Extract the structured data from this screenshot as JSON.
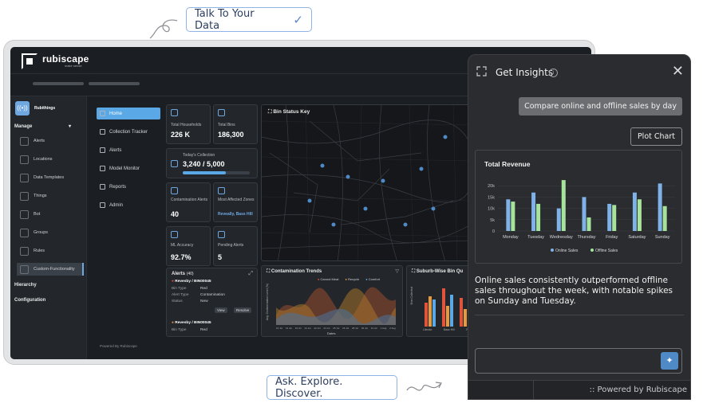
{
  "callouts": {
    "top": "Talk To Your Data",
    "bottom": "Ask. Explore. Discover."
  },
  "app": {
    "brand": "rubiscape",
    "brand_sub": "make sense",
    "workspace": "Rubithings",
    "workspace_icon": "((•))",
    "nav_section": "Manage",
    "nav_items": [
      "Alerts",
      "Locations",
      "Data Templates",
      "Things",
      "Bot",
      "Groups",
      "Rules",
      "Custom-Functionality"
    ],
    "nav_bottom": [
      "Hierarchy",
      "Configuration"
    ],
    "menu_items": [
      "Home",
      "Collection Tracker",
      "Alerts",
      "Model Monitor",
      "Reports",
      "Admin"
    ],
    "menu_footer": "Powered By Rubiscape"
  },
  "kpis": {
    "total_households_label": "Total Households",
    "total_households": "226 K",
    "total_bins_label": "Total Bins",
    "total_bins": "186,300",
    "todays_collection_label": "Today's Collection",
    "todays_collection": "3,240 / 5,000",
    "todays_collection_progress": 0.648,
    "contamination_label": "Contamination Alerts",
    "contamination": "40",
    "affected_label": "Most Affected Zones",
    "affected": "Reveally, Bass Hill",
    "ml_label": "ML Accuracy",
    "ml": "92.7%",
    "pending_label": "Pending Alerts",
    "pending": "5"
  },
  "map": {
    "title": "Bin Status Key"
  },
  "alerts_panel": {
    "title": "Alerts",
    "count": "(40)",
    "item1": {
      "title": "Revesby / BIN00045",
      "bin_type_label": "Bin Type",
      "bin_type": "Red",
      "alert_type_label": "Alert Type",
      "alert_type": "Contamination",
      "status_label": "Status",
      "status": "New"
    },
    "view_btn": "View",
    "resolve_btn": "Resolve",
    "item2": {
      "title": "Revesby / BIN00045",
      "bin_type_label": "Bin Type",
      "bin_type": "Red"
    }
  },
  "contamination_panel": {
    "title": "Contamination Trends",
    "legend": [
      "Cannot Meat",
      "Recycle",
      "Comfort"
    ],
    "ylabel": "Avg. Contamination Level (%)",
    "xlabel": "Dates",
    "xticks": [
      "10 Jul",
      "13 Jul",
      "19 Jul",
      "21 Jul",
      "22 Jul",
      "24 Jul",
      "25 Jul",
      "26 Jul",
      "28 Jul",
      "30 Jul",
      "31 Jul",
      "1 Aug",
      "2 Aug"
    ]
  },
  "suburb_panel": {
    "title": "Suburb-Wise Bin Qu",
    "ylabel": "Bins Collected",
    "xticks": [
      "Lliendo",
      "Bass Hill",
      "Revesby"
    ]
  },
  "insights": {
    "title": "Get Insights",
    "info_icon": "i",
    "close_icon": "✕",
    "user_message": "Compare online and offline sales by day",
    "plot_button": "Plot Chart",
    "answer": "Online sales consistently outperformed offline sales throughout the week, with notable spikes on Sunday and Tuesday.",
    "input_placeholder": "",
    "send_icon": "sparkle-icon",
    "powered_by": ":: Powered by Rubiscape"
  },
  "chart_data": {
    "type": "bar",
    "title": "Total Revenue",
    "categories": [
      "Monday",
      "Tuesday",
      "Wednesday",
      "Thursday",
      "Friday",
      "Saturday",
      "Sunday"
    ],
    "series": [
      {
        "name": "Online Sales",
        "color": "#7fb2e6",
        "values": [
          14000,
          17000,
          10000,
          15000,
          12000,
          17000,
          21000
        ]
      },
      {
        "name": "Offline Sales",
        "color": "#a6e39b",
        "values": [
          13000,
          12000,
          22500,
          6000,
          11500,
          14000,
          11000
        ]
      }
    ],
    "yticks": [
      "0",
      "5k",
      "10k",
      "15k",
      "20k"
    ],
    "ylim": [
      0,
      25000
    ],
    "legend_position": "bottom"
  }
}
